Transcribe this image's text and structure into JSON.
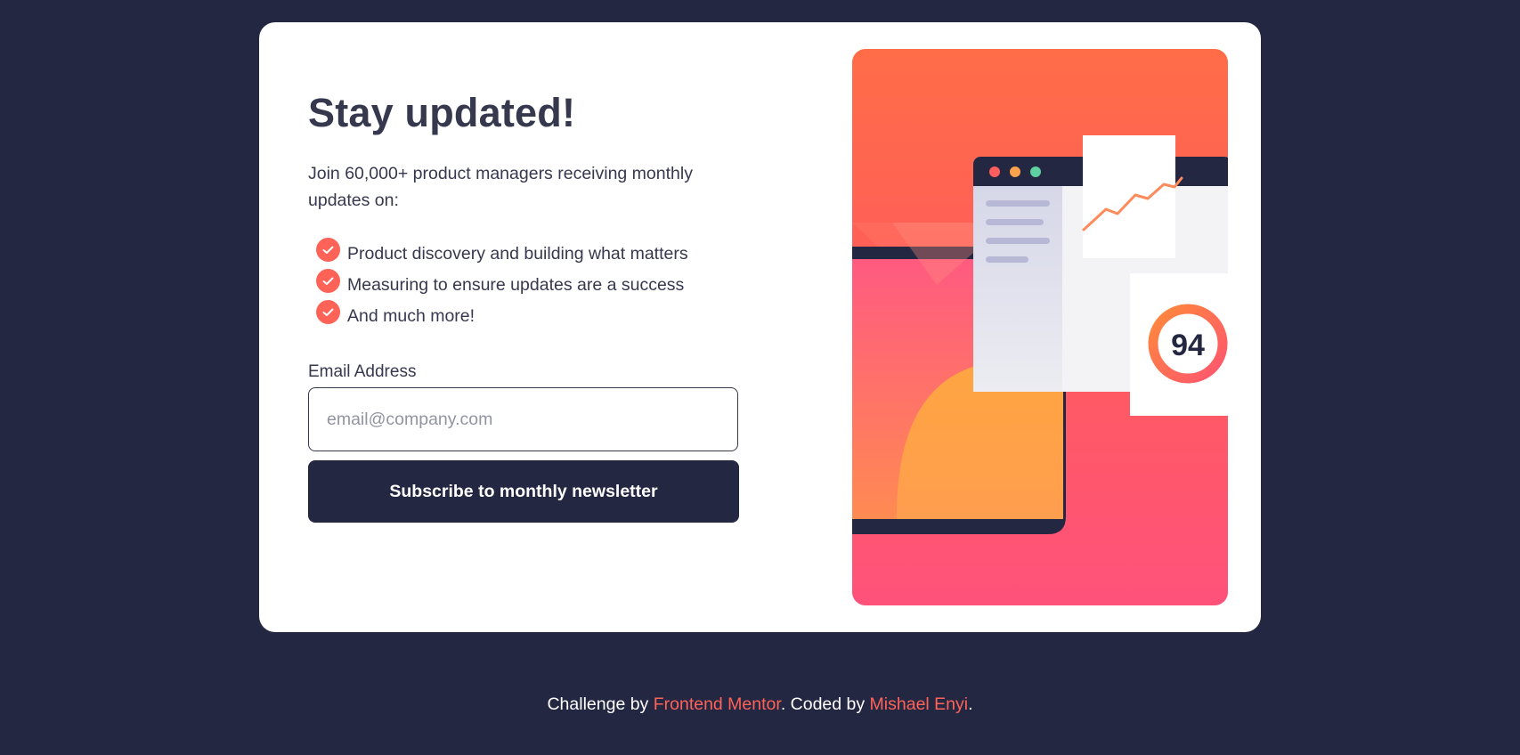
{
  "colors": {
    "background": "#242742",
    "card": "#ffffff",
    "accent": "#ff6257",
    "text": "#36384e",
    "button": "#242742"
  },
  "card": {
    "title": "Stay updated!",
    "intro": "Join 60,000+ product managers receiving monthly updates on:",
    "features": [
      {
        "icon": "check-icon",
        "label": "Product discovery and building what matters"
      },
      {
        "icon": "check-icon",
        "label": "Measuring to ensure updates are a success"
      },
      {
        "icon": "check-icon",
        "label": "And much more!"
      }
    ],
    "form": {
      "email_label": "Email Address",
      "email_placeholder": "email@company.com",
      "email_value": "",
      "submit_label": "Subscribe to monthly newsletter"
    },
    "illustration": {
      "score": "94"
    }
  },
  "footer": {
    "prefix": "Challenge by ",
    "link1": "Frontend Mentor",
    "middle": ". Coded by ",
    "link2": "Mishael Enyi",
    "suffix": "."
  }
}
